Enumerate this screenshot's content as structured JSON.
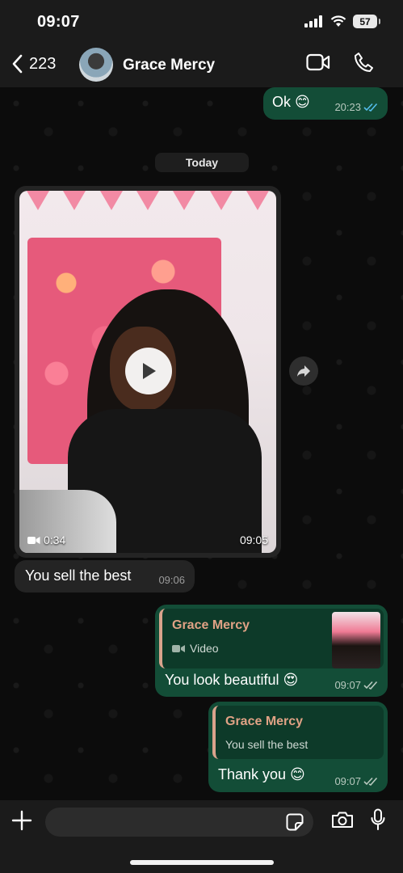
{
  "status_bar": {
    "time": "09:07",
    "battery": "57"
  },
  "header": {
    "back_count": "223",
    "contact_name": "Grace Mercy"
  },
  "messages": {
    "ok": {
      "text": "Ok 😊",
      "time": "20:23"
    },
    "day_separator": "Today",
    "video": {
      "duration": "0:34",
      "time": "09:05"
    },
    "incoming_1": {
      "text": "You sell the best",
      "time": "09:06"
    },
    "reply_1": {
      "quote_name": "Grace Mercy",
      "quote_text": "Video",
      "text": "You look beautiful 😍",
      "time": "09:07"
    },
    "reply_2": {
      "quote_name": "Grace Mercy",
      "quote_text": "You sell the best",
      "text": "Thank you 😊",
      "time": "09:07"
    }
  },
  "input": {
    "placeholder": ""
  },
  "colors": {
    "outgoing": "#134d37",
    "incoming": "#242424",
    "quote_accent": "#e0a285",
    "read_tick": "#53bdeb"
  }
}
